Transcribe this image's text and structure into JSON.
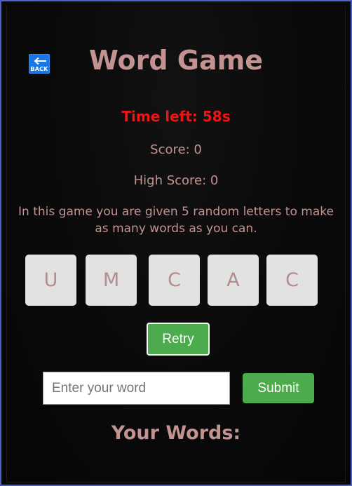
{
  "back_button": {
    "label": "BACK",
    "icon": "arrow-left-icon"
  },
  "title": "Word Game",
  "timer": "Time left: 58s",
  "score": "Score: 0",
  "high_score": "High Score: 0",
  "description": "In this game you are given 5 random letters to make as many words as you can.",
  "letters": [
    "U",
    "M",
    "C",
    "A",
    "C"
  ],
  "retry_label": "Retry",
  "word_input": {
    "value": "",
    "placeholder": "Enter your word"
  },
  "submit_label": "Submit",
  "your_words_heading": "Your Words:",
  "colors": {
    "accent_text": "#c39391",
    "timer": "#ee1515",
    "button_green": "#4cab4c",
    "tile_bg": "#e2e2e2",
    "back_blue": "#1877e6",
    "frame_border": "#4a63c8"
  }
}
